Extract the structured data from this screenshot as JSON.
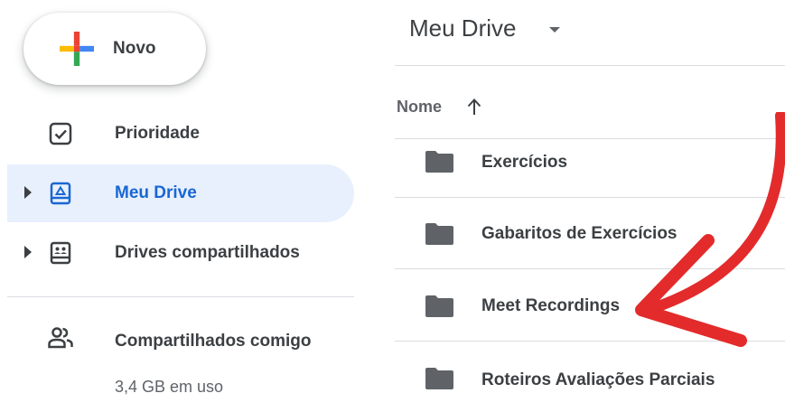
{
  "sidebar": {
    "new_button": {
      "label": "Novo"
    },
    "items": [
      {
        "label": "Prioridade",
        "icon": "priority-checkbox-icon",
        "active": false
      },
      {
        "label": "Meu Drive",
        "icon": "my-drive-icon",
        "active": true
      },
      {
        "label": "Drives compartilhados",
        "icon": "shared-drives-icon",
        "active": false
      },
      {
        "label": "Compartilhados comigo",
        "icon": "people-icon",
        "active": false
      }
    ],
    "storage": "3,4 GB em uso"
  },
  "main": {
    "title": "Meu Drive",
    "column_header": "Nome",
    "files": [
      {
        "name": "Exercícios",
        "type": "folder"
      },
      {
        "name": "Gabaritos de Exercícios",
        "type": "folder"
      },
      {
        "name": "Meet Recordings",
        "type": "folder"
      },
      {
        "name": "Roteiros Avaliações Parciais",
        "type": "folder"
      }
    ]
  },
  "colors": {
    "accent": "#1967d2",
    "active_background": "#e8f0fe",
    "folder_icon": "#5f6368",
    "annotation_arrow": "#e32b2b",
    "google_blue": "#4285f4",
    "google_red": "#ea4335",
    "google_yellow": "#fbbc04",
    "google_green": "#34a853"
  }
}
